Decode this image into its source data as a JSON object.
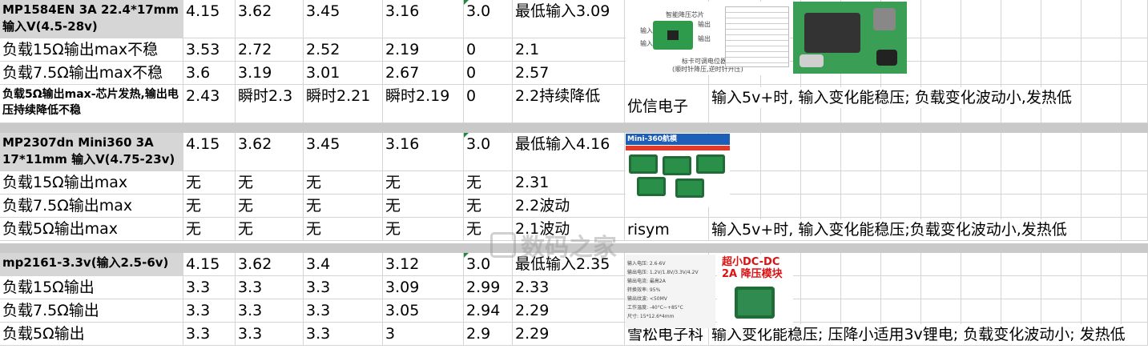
{
  "s1": {
    "header": {
      "label": "MP1584EN 3A 22.4*17mm 输入V(4.5-28v)",
      "v": [
        "4.15",
        "3.62",
        "3.45",
        "3.16",
        "3.0",
        "最低输入3.09"
      ]
    },
    "rows": [
      {
        "label": "负载15Ω输出max不稳",
        "v": [
          "3.53",
          "2.72",
          "2.52",
          "2.19",
          "0",
          "2.1"
        ]
      },
      {
        "label": "负载7.5Ω输出max不稳",
        "v": [
          "3.6",
          "3.19",
          "3.01",
          "2.67",
          "0",
          "2.57"
        ]
      },
      {
        "label": "负载5Ω输出max-芯片发热,输出电压持续降低不稳",
        "v": [
          "2.43",
          "瞬时2.3",
          "瞬时2.21",
          "瞬时2.19",
          "0",
          "2.2持续降低"
        ]
      }
    ],
    "brand": "优信电子",
    "note": "输入5v+时, 输入变化能稳压; 负载变化波动小,发热低",
    "img_labels": [
      "智能降压芯片",
      "输入",
      "输出",
      "输入",
      "输出",
      "标卡可调电位器",
      "(顺时针降压,逆时针升压)"
    ]
  },
  "s2": {
    "header": {
      "label": "MP2307dn Mini360 3A 17*11mm 输入V(4.75-23v)",
      "v": [
        "4.15",
        "3.62",
        "3.45",
        "3.16",
        "3.0",
        "最低输入4.16"
      ]
    },
    "rows": [
      {
        "label": "负载15Ω输出max",
        "v": [
          "无",
          "无",
          "无",
          "无",
          "无",
          "2.31"
        ]
      },
      {
        "label": "负载7.5Ω输出max",
        "v": [
          "无",
          "无",
          "无",
          "无",
          "无",
          "2.2波动"
        ]
      },
      {
        "label": "负载5Ω输出max",
        "v": [
          "无",
          "无",
          "无",
          "无",
          "无",
          "2.1波动"
        ]
      }
    ],
    "brand": "risym",
    "note": "输入5v+时, 输入变化能稳压;负载变化波动小,发热低",
    "img_banner": "Mini-360航模"
  },
  "s3": {
    "header": {
      "label": "mp2161-3.3v(输入2.5-6v)",
      "v": [
        "4.15",
        "3.62",
        "3.4",
        "3.12",
        "3.0",
        "最低输入2.35"
      ]
    },
    "rows": [
      {
        "label": "负载15Ω输出",
        "v": [
          "3.3",
          "3.3",
          "3.3",
          "3.09",
          "2.99",
          "2.33"
        ]
      },
      {
        "label": "负载7.5Ω输出",
        "v": [
          "3.3",
          "3.3",
          "3.3",
          "3.05",
          "2.94",
          "2.29"
        ]
      },
      {
        "label": "负载5Ω输出",
        "v": [
          "3.3",
          "3.3",
          "3.3",
          "3",
          "2.9",
          "2.29"
        ]
      }
    ],
    "brand": "雪松电子科",
    "note": "输入变化能稳压; 压降小适用3v锂电; 负载变化波动小; 发热低",
    "img_title1": "超小DC-DC",
    "img_title2": "2A 降压模块",
    "img_specs": [
      "输入电压: 2.6-6V",
      "输出电压: 1.2V/1.8V/3.3V/4.2V",
      "输出电流: 最高2A",
      "转换效率: 95%",
      "输出纹波: <50MV",
      "工作温度: -40°C~+85°C",
      "尺寸: 15*12.6*4mm"
    ]
  },
  "watermark": "数码之家"
}
